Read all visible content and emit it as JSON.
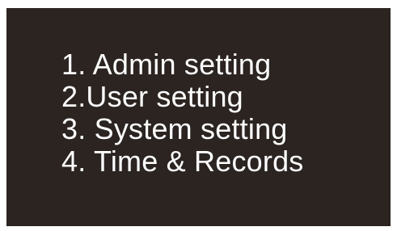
{
  "menu": {
    "items": [
      {
        "label": "1. Admin setting"
      },
      {
        "label": "2.User setting"
      },
      {
        "label": "3. System setting"
      },
      {
        "label": "4. Time & Records"
      }
    ]
  },
  "colors": {
    "screen_background": "#2b2421",
    "text": "#ffffff",
    "page_background": "#ffffff"
  }
}
